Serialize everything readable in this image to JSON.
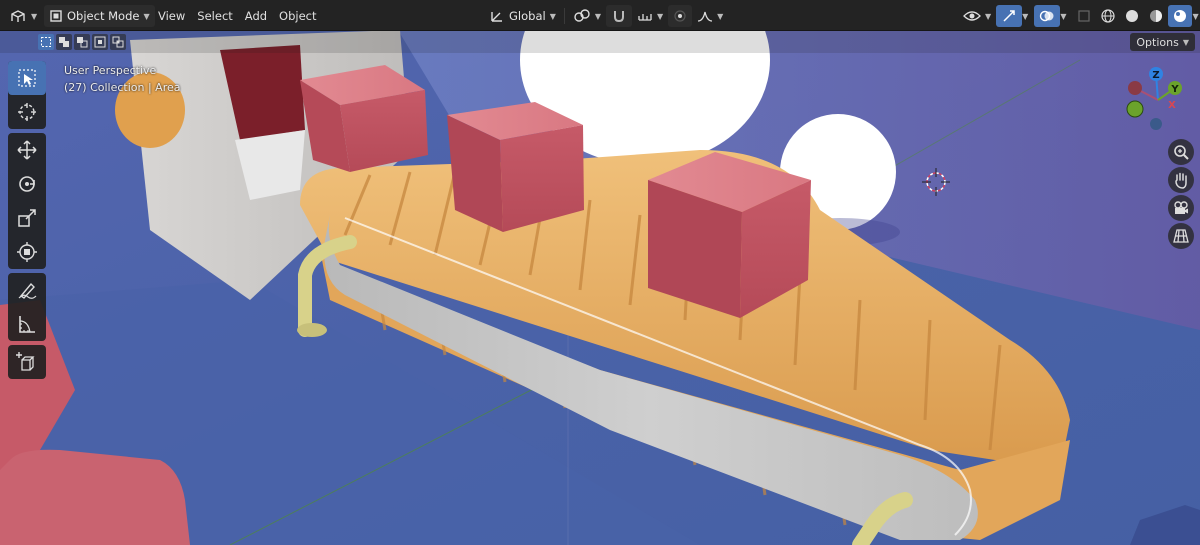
{
  "header": {
    "mode_label": "Object Mode",
    "menus": [
      "View",
      "Select",
      "Add",
      "Object"
    ],
    "transform_orientation": "Global"
  },
  "toolheader": {
    "options_label": "Options"
  },
  "viewport": {
    "perspective_label": "User Perspective",
    "collection_label": "(27) Collection | Area"
  },
  "gizmo": {
    "z_label": "Z",
    "y_label": "Y",
    "x_label": "X",
    "colors": {
      "x": "#d94752",
      "y": "#6ba32b",
      "z": "#2f83e3"
    }
  },
  "toolbar": {
    "tools": [
      "select-box",
      "cursor",
      "move",
      "rotate",
      "scale",
      "transform",
      "annotate",
      "measure",
      "add-cube"
    ]
  },
  "colors": {
    "accent": "#4772b3",
    "header_bg": "#232323"
  }
}
